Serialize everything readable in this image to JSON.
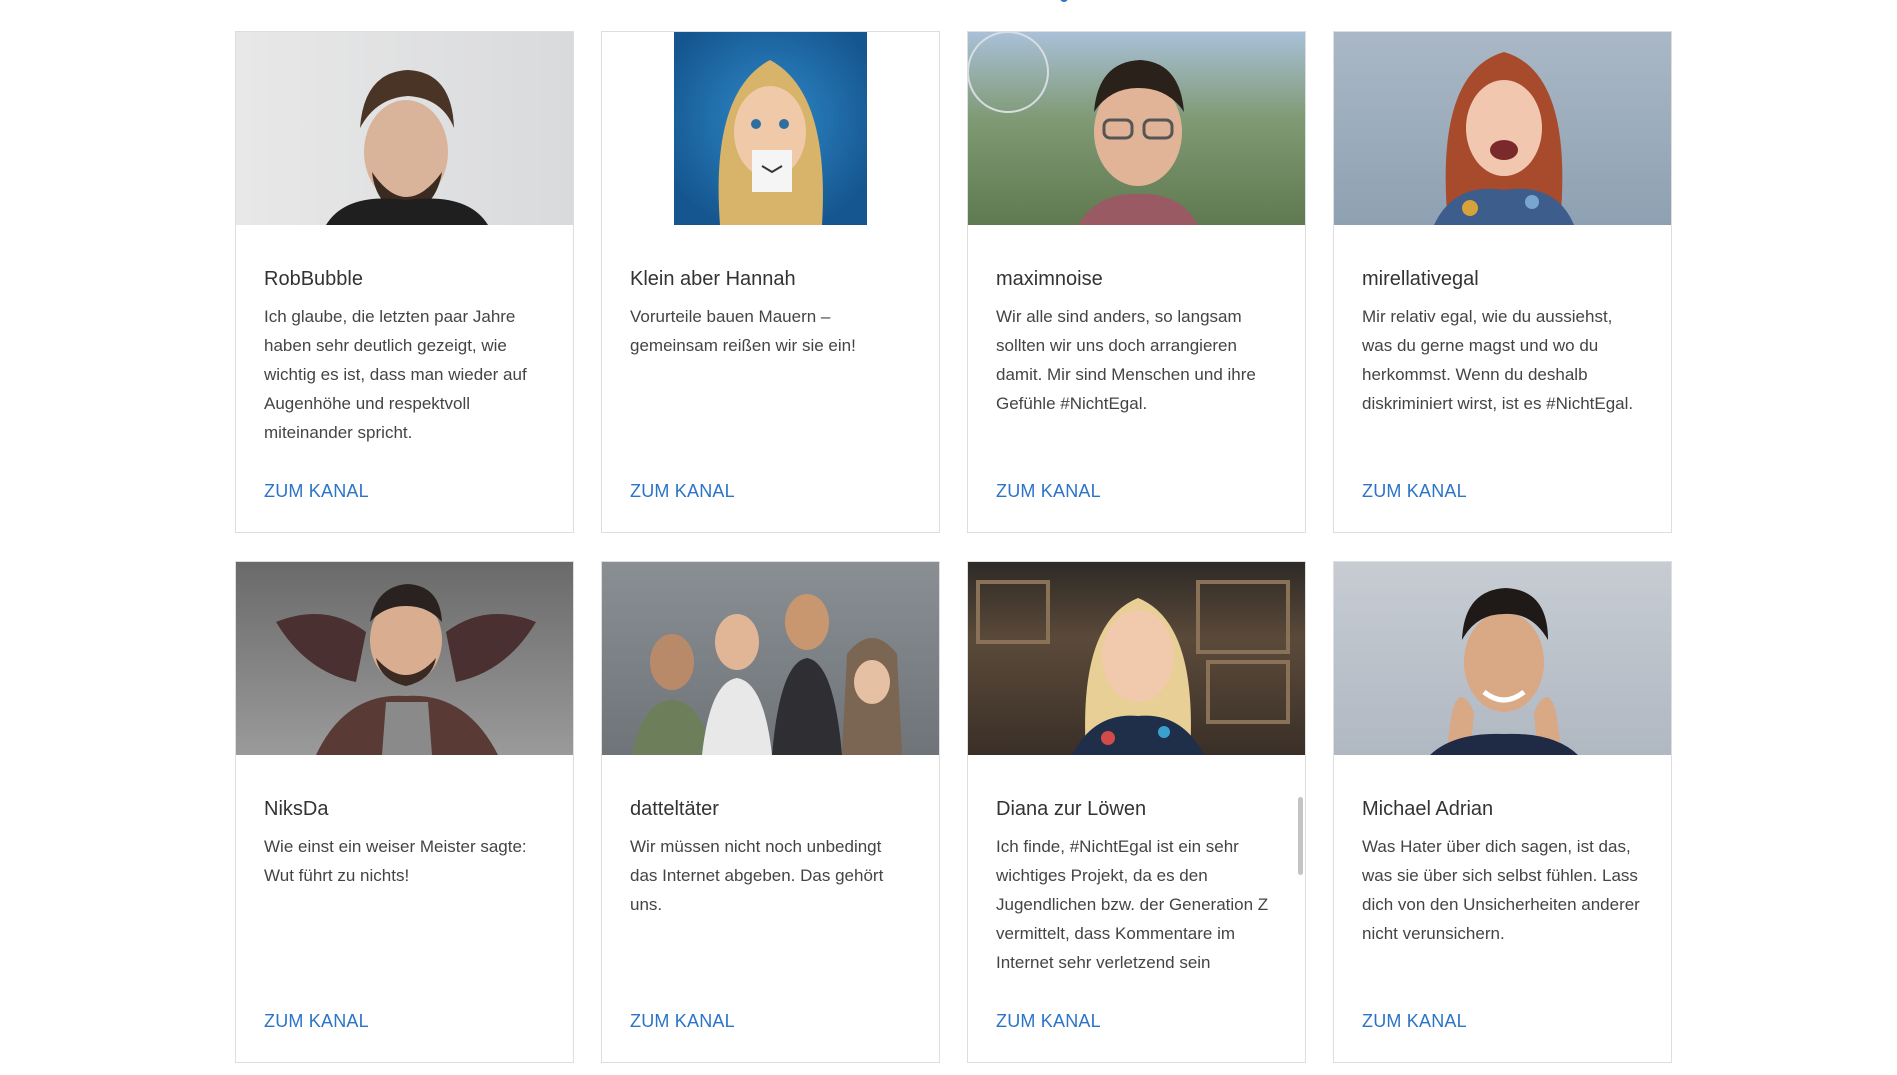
{
  "cards": [
    {
      "name": "RobBubble",
      "description": "Ich glaube, die letzten paar Jahre haben sehr deutlich gezeigt, wie wichtig es ist, dass man wieder auf Augenhöhe und respektvoll miteinander spricht.",
      "cta": "ZUM KANAL"
    },
    {
      "name": "Klein aber Hannah",
      "description": "Vorurteile bauen Mauern – gemeinsam reißen wir sie ein!",
      "cta": "ZUM KANAL"
    },
    {
      "name": "maximnoise",
      "description": "Wir alle sind anders, so langsam sollten wir uns doch arrangieren damit. Mir sind Menschen und ihre Gefühle #NichtEgal.",
      "cta": "ZUM KANAL"
    },
    {
      "name": "mirellativegal",
      "description": "Mir relativ egal, wie du aussiehst, was du gerne magst und wo du herkommst. Wenn du deshalb diskriminiert wirst, ist es #NichtEgal.",
      "cta": "ZUM KANAL"
    },
    {
      "name": "NiksDa",
      "description": "Wie einst ein weiser Meister sagte: Wut führt zu nichts!",
      "cta": "ZUM KANAL"
    },
    {
      "name": "datteltäter",
      "description": "Wir müssen nicht noch unbedingt das Internet abgeben. Das gehört uns.",
      "cta": "ZUM KANAL"
    },
    {
      "name": "Diana zur Löwen",
      "description": "Ich finde, #NichtEgal ist ein sehr wichtiges Projekt, da es den Jugendlichen bzw. der Generation Z vermittelt, dass Kommentare im Internet sehr verletzend sein",
      "cta": "ZUM KANAL"
    },
    {
      "name": "Michael Adrian",
      "description": "Was Hater über dich sagen, ist das, was sie über sich selbst fühlen. Lass dich von den Unsicherheiten anderer nicht verunsichern.",
      "cta": "ZUM KANAL"
    }
  ],
  "colors": {
    "link": "#2b74c7",
    "border": "#dedede",
    "text": "#333333"
  }
}
